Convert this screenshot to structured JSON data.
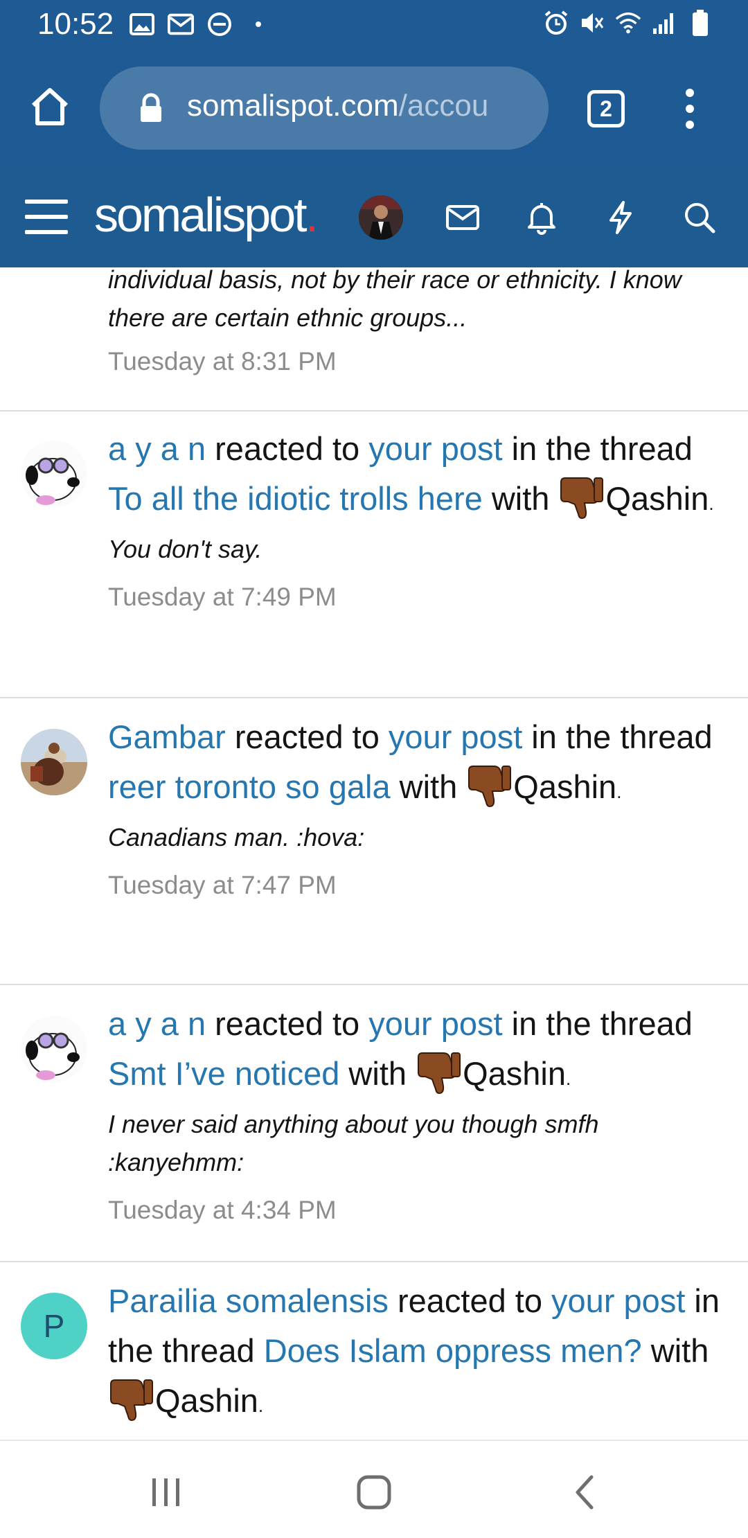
{
  "status_bar": {
    "time": "10:52",
    "left_icons": [
      "gallery-icon",
      "mail-icon",
      "dnd-icon",
      "dot-icon"
    ],
    "right_icons": [
      "alarm-icon",
      "mute-icon",
      "wifi-icon",
      "signal-icon",
      "battery-icon"
    ]
  },
  "browser": {
    "url_domain": "somalispot.com",
    "url_path": "/accou",
    "tab_count": "2"
  },
  "site_header": {
    "logo_text": "somalispot",
    "logo_dot": ".",
    "icons": [
      "menu-icon",
      "avatar",
      "inbox-icon",
      "bell-icon",
      "bolt-icon",
      "search-icon"
    ]
  },
  "feed": {
    "first_partial": {
      "snippet": "individual basis, not by their race or ethnicity. I know there are certain ethnic groups...",
      "time": "Tuesday at 8:31 PM"
    },
    "items": [
      {
        "user": "a y a n",
        "verb": " reacted to ",
        "post_link": "your post",
        "in_thread": " in the thread ",
        "thread": "To all the idiotic trolls here",
        "with": " with ",
        "reaction": "Qashin",
        "reaction_dot": ".",
        "snippet": "You don't say.",
        "time": "Tuesday at 7:49 PM"
      },
      {
        "user": "Gambar",
        "verb": " reacted to ",
        "post_link": "your post",
        "in_thread": " in the thread ",
        "thread": "reer toronto so gala",
        "with": " with ",
        "reaction": "Qashin",
        "reaction_dot": ".",
        "snippet": "Canadians man. :hova:",
        "time": "Tuesday at 7:47 PM"
      },
      {
        "user": "a y a n",
        "verb": " reacted to ",
        "post_link": "your post",
        "in_thread": " in the thread ",
        "thread": "Smt I’ve noticed",
        "with": " with ",
        "reaction": "Qashin",
        "reaction_dot": ".",
        "snippet": "I never said anything about you though smfh :kanyehmm:",
        "time": "Tuesday at 4:34 PM"
      },
      {
        "user": "Parailia somalensis",
        "avatar_letter": "P",
        "verb": " reacted to ",
        "post_link": "your post",
        "in_thread": " in the thread ",
        "thread": "Does Islam oppress men?",
        "with": " with ",
        "reaction": "Qashin",
        "reaction_dot": "."
      }
    ]
  },
  "colors": {
    "header_blue": "#1d5b90",
    "link_blue": "#2577b1",
    "timestamp_gray": "#8c8c8c",
    "avatar_teal": "#4fd1c5"
  },
  "nav": {
    "icons": [
      "recents-icon",
      "home-icon",
      "back-icon"
    ]
  }
}
